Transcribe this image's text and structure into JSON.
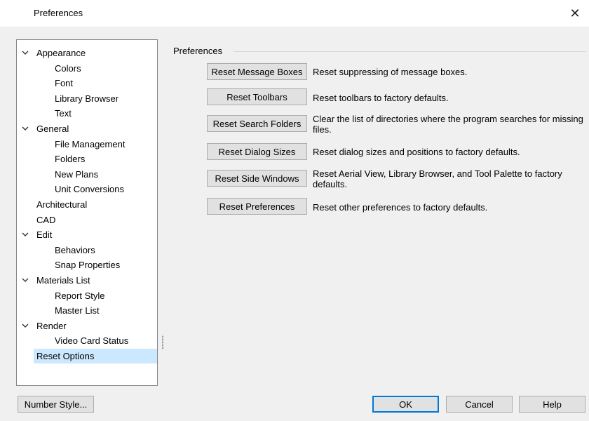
{
  "window": {
    "title": "Preferences",
    "close_glyph": "✕"
  },
  "tree": {
    "chevron_glyph": "⌄",
    "items": [
      {
        "label": "Appearance",
        "level": 0,
        "expandable": true
      },
      {
        "label": "Colors",
        "level": 1
      },
      {
        "label": "Font",
        "level": 1
      },
      {
        "label": "Library Browser",
        "level": 1
      },
      {
        "label": "Text",
        "level": 1
      },
      {
        "label": "General",
        "level": 0,
        "expandable": true
      },
      {
        "label": "File Management",
        "level": 1
      },
      {
        "label": "Folders",
        "level": 1
      },
      {
        "label": "New Plans",
        "level": 1
      },
      {
        "label": "Unit Conversions",
        "level": 1
      },
      {
        "label": "Architectural",
        "level": 0
      },
      {
        "label": "CAD",
        "level": 0
      },
      {
        "label": "Edit",
        "level": 0,
        "expandable": true
      },
      {
        "label": "Behaviors",
        "level": 1
      },
      {
        "label": "Snap Properties",
        "level": 1
      },
      {
        "label": "Materials List",
        "level": 0,
        "expandable": true
      },
      {
        "label": "Report Style",
        "level": 1
      },
      {
        "label": "Master List",
        "level": 1
      },
      {
        "label": "Render",
        "level": 0,
        "expandable": true
      },
      {
        "label": "Video Card Status",
        "level": 1
      },
      {
        "label": "Reset Options",
        "level": 0,
        "selected": true
      }
    ]
  },
  "panel": {
    "group_label": "Preferences",
    "resets": [
      {
        "button": "Reset Message Boxes",
        "desc": "Reset suppressing of message boxes."
      },
      {
        "button": "Reset Toolbars",
        "desc": "Reset toolbars to factory defaults."
      },
      {
        "button": "Reset Search Folders",
        "desc": "Clear the list of directories where the program searches for missing files."
      },
      {
        "button": "Reset Dialog Sizes",
        "desc": "Reset dialog sizes and positions to factory defaults."
      },
      {
        "button": "Reset Side Windows",
        "desc": "Reset Aerial View, Library Browser, and Tool Palette to factory defaults."
      },
      {
        "button": "Reset Preferences",
        "desc": "Reset other preferences to factory defaults."
      }
    ]
  },
  "footer": {
    "number_style": "Number Style...",
    "ok": "OK",
    "cancel": "Cancel",
    "help": "Help"
  }
}
